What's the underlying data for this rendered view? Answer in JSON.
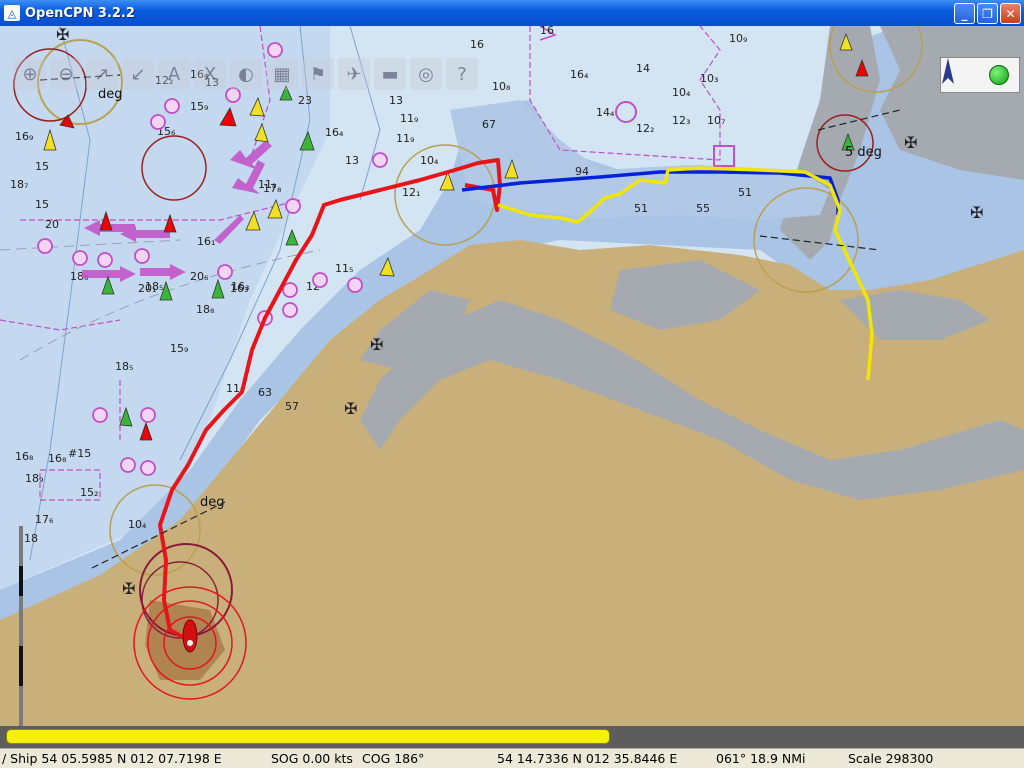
{
  "window": {
    "title": "OpenCPN 3.2.2",
    "app_icon": "opencpn-icon"
  },
  "toolbar": {
    "buttons": [
      {
        "icon": "zoom-in-icon",
        "glyph": "⊕"
      },
      {
        "icon": "zoom-out-icon",
        "glyph": "⊖"
      },
      {
        "icon": "scale-in-icon",
        "glyph": "↗"
      },
      {
        "icon": "scale-out-icon",
        "glyph": "↙"
      },
      {
        "icon": "pan-icon",
        "glyph": "A"
      },
      {
        "icon": "tide-icon",
        "glyph": "X"
      },
      {
        "icon": "chart-info-icon",
        "glyph": "◐"
      },
      {
        "icon": "route-icon",
        "glyph": "▦"
      },
      {
        "icon": "track-icon",
        "glyph": "⚑"
      },
      {
        "icon": "mob-icon",
        "glyph": "✈"
      },
      {
        "icon": "print-icon",
        "glyph": "▬"
      },
      {
        "icon": "settings-icon",
        "glyph": "◎"
      },
      {
        "icon": "help-icon",
        "glyph": "?"
      }
    ]
  },
  "chart_labels": {
    "deg_1": "deg",
    "deg_2": "5 deg",
    "deg_3": "deg"
  },
  "depths": [
    {
      "t": "16"
    },
    {
      "t": "16"
    },
    {
      "t": "10₉"
    },
    {
      "t": "16₄"
    },
    {
      "t": "14"
    },
    {
      "t": "10₃"
    },
    {
      "t": "12₂"
    },
    {
      "t": "16₄"
    },
    {
      "t": "15₉"
    },
    {
      "t": "23"
    },
    {
      "t": "16₄"
    },
    {
      "t": "13"
    },
    {
      "t": "10₄"
    },
    {
      "t": "12₃"
    },
    {
      "t": "10₇"
    },
    {
      "t": "14₄"
    },
    {
      "t": "12₂"
    },
    {
      "t": "11₉"
    },
    {
      "t": "10₄"
    },
    {
      "t": "12₁"
    },
    {
      "t": "13"
    },
    {
      "t": "16₉"
    },
    {
      "t": "15"
    },
    {
      "t": "18₇"
    },
    {
      "t": "15"
    },
    {
      "t": "20"
    },
    {
      "t": "20₆"
    },
    {
      "t": "17₈"
    },
    {
      "t": "16₃"
    },
    {
      "t": "18₈"
    },
    {
      "t": "18₅"
    },
    {
      "t": "15₉"
    },
    {
      "t": "11₉"
    },
    {
      "t": "16₈"
    },
    {
      "t": "18₉"
    },
    {
      "t": "17₆"
    },
    {
      "t": "15₂"
    },
    {
      "t": "10₄"
    },
    {
      "t": "63"
    },
    {
      "t": "57"
    },
    {
      "t": "94"
    },
    {
      "t": "51"
    },
    {
      "t": "55"
    },
    {
      "t": "51"
    },
    {
      "t": "67"
    },
    {
      "t": "10₈"
    },
    {
      "t": "11₅"
    },
    {
      "t": "12"
    },
    {
      "t": "15₆"
    },
    {
      "t": "13"
    },
    {
      "t": "11₉"
    },
    {
      "t": "16₁"
    },
    {
      "t": "18₈"
    },
    {
      "t": "20₁"
    },
    {
      "t": "18₅"
    },
    {
      "t": "16₃"
    },
    {
      "t": "11₈"
    },
    {
      "t": "#15"
    },
    {
      "t": "16₈"
    },
    {
      "t": "18"
    }
  ],
  "status": {
    "ship": "/ Ship 54 05.5985 N   012 07.7198 E",
    "sog": "SOG 0.00 kts",
    "cog": "COG 186°",
    "cursor": "54 14.7336 N   012 35.8446 E",
    "bearing": "061°  18.9 NMi",
    "scale": "Scale 298300"
  },
  "colors": {
    "land": "#c9b07a",
    "shallow": "#9ab5d8",
    "deep": "#d3e4f3",
    "dry": "#a4aab0",
    "track_red": "#e8141a",
    "route_blue": "#0022dd",
    "route_yellow": "#f2e600",
    "nav_magenta": "#c24ec8",
    "piano_yellow": "#f5f000"
  }
}
